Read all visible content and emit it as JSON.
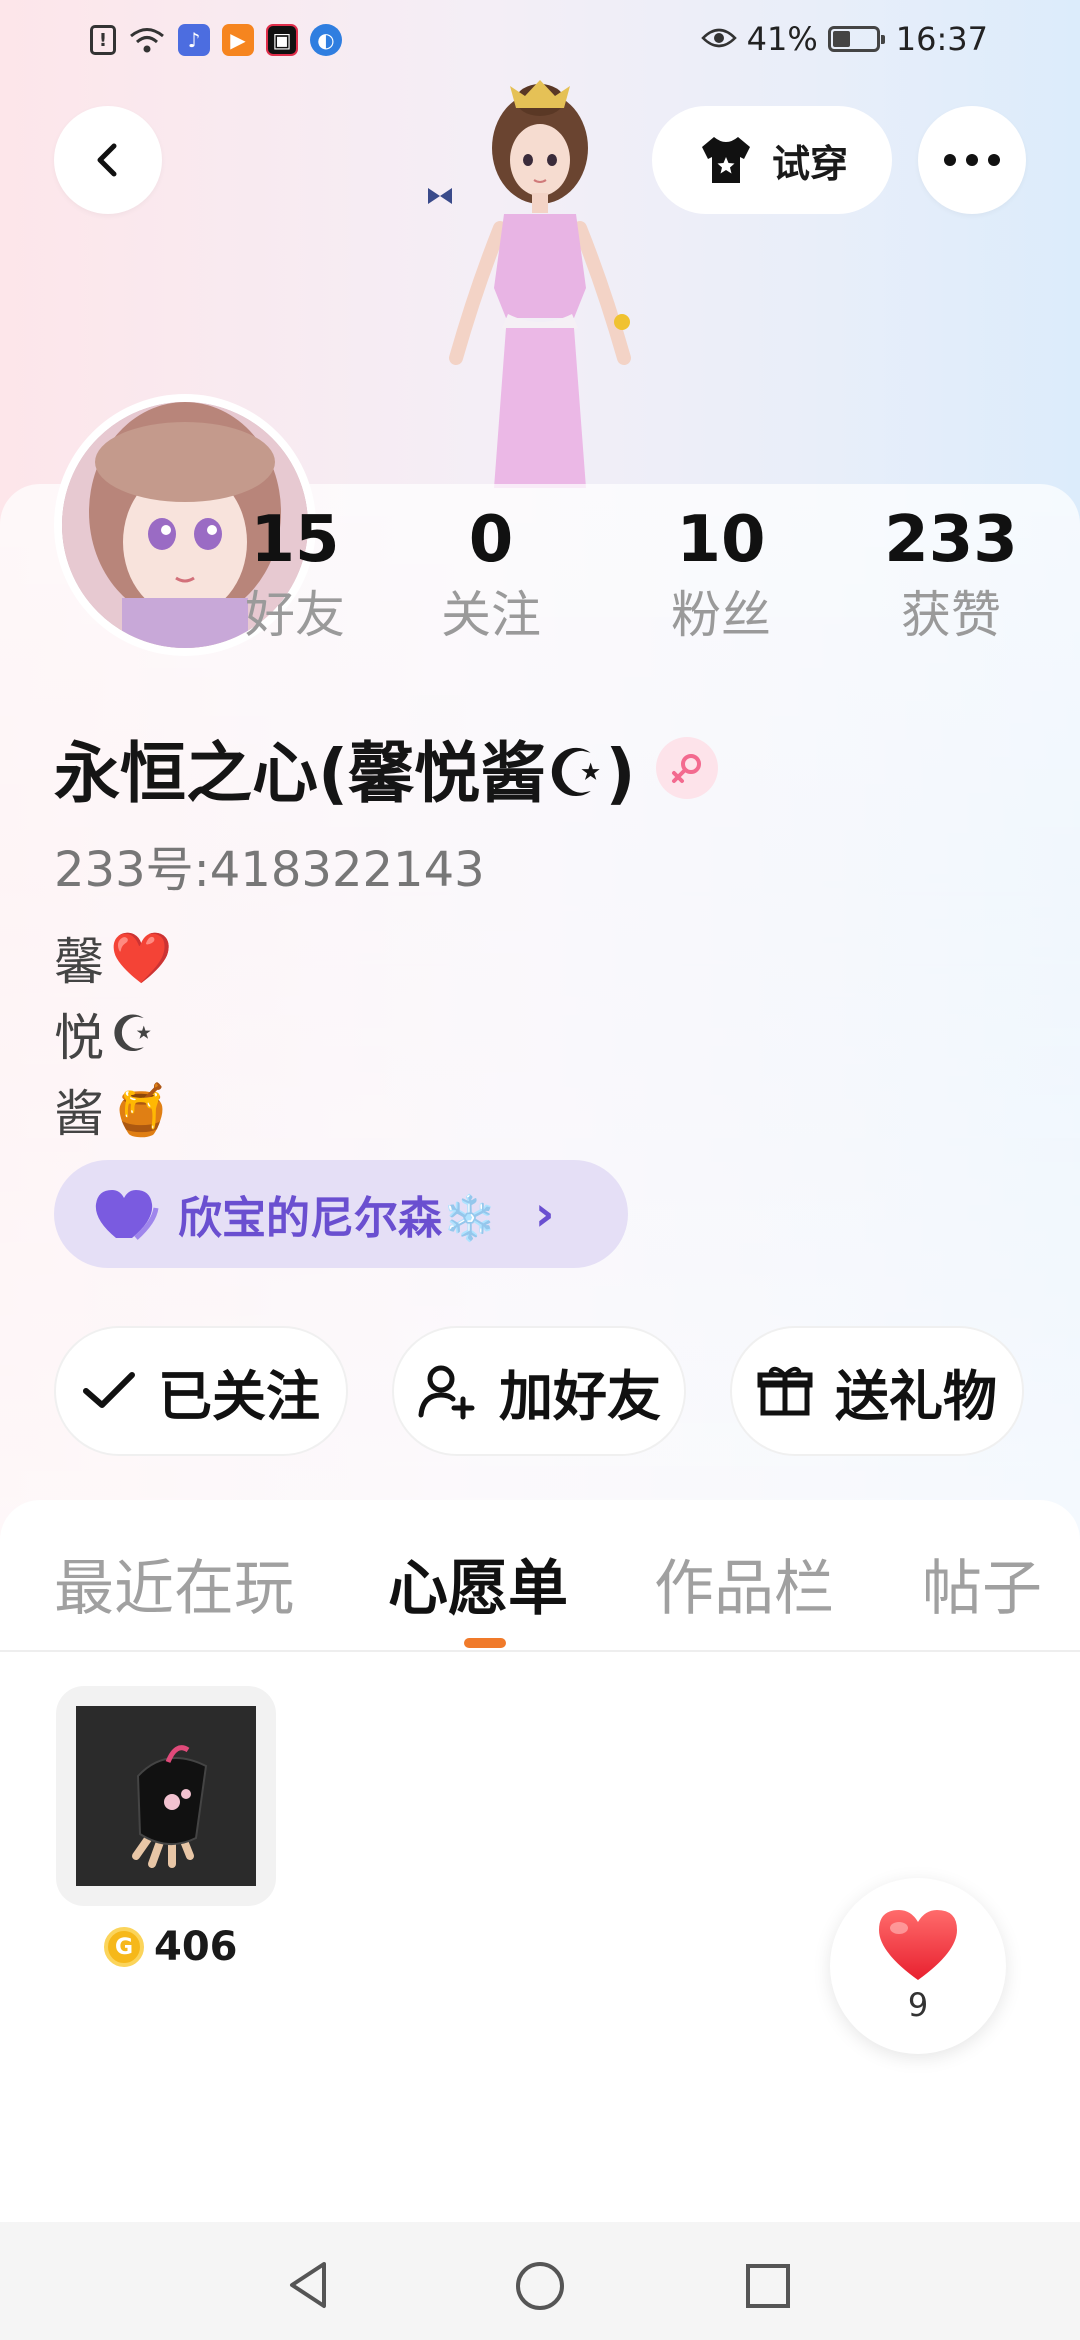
{
  "status_bar": {
    "battery_text": "41%",
    "battery_level": 0.41,
    "time": "16:37",
    "left_icons": [
      "alert-icon",
      "wifi-icon",
      "music-app-icon",
      "video-app-icon",
      "camera-app-icon",
      "browser-app-icon"
    ]
  },
  "header": {
    "back_icon": "back-arrow-icon",
    "tryon_label": "试穿",
    "tryon_icon": "shirt-icon",
    "more_icon": "more-dots-icon"
  },
  "stats": [
    {
      "value": "15",
      "label": "好友"
    },
    {
      "value": "0",
      "label": "关注"
    },
    {
      "value": "10",
      "label": "粉丝"
    },
    {
      "value": "233",
      "label": "获赞"
    }
  ],
  "profile": {
    "username": "永恒之心(馨悦酱☪)",
    "gender_icon": "female-icon",
    "user_id": "233号:418322143",
    "bio": [
      {
        "text": "馨",
        "emoji": "❤️"
      },
      {
        "text": "悦",
        "emoji": "☪"
      },
      {
        "text": "酱",
        "emoji": "🍯"
      }
    ]
  },
  "club": {
    "label": "欣宝的尼尔森❄️",
    "icon": "purple-heart-icon",
    "chevron": "›"
  },
  "actions": {
    "followed_label": "已关注",
    "add_friend_label": "加好友",
    "gift_label": "送礼物"
  },
  "tabs": [
    {
      "label": "最近在玩",
      "active": false
    },
    {
      "label": "心愿单",
      "active": true
    },
    {
      "label": "作品栏",
      "active": false
    },
    {
      "label": "帖子",
      "active": false
    }
  ],
  "wishlist": [
    {
      "item_icon": "glove-item-icon",
      "price": "406",
      "currency_icon": "coin-icon"
    }
  ],
  "like_button": {
    "icon": "heart-icon",
    "count": "9"
  },
  "colors": {
    "accent_orange": "#f07a2a",
    "club_purple": "#6a4fd0",
    "club_bg": "#e5dff6",
    "coin_gold": "#f6b81a"
  }
}
